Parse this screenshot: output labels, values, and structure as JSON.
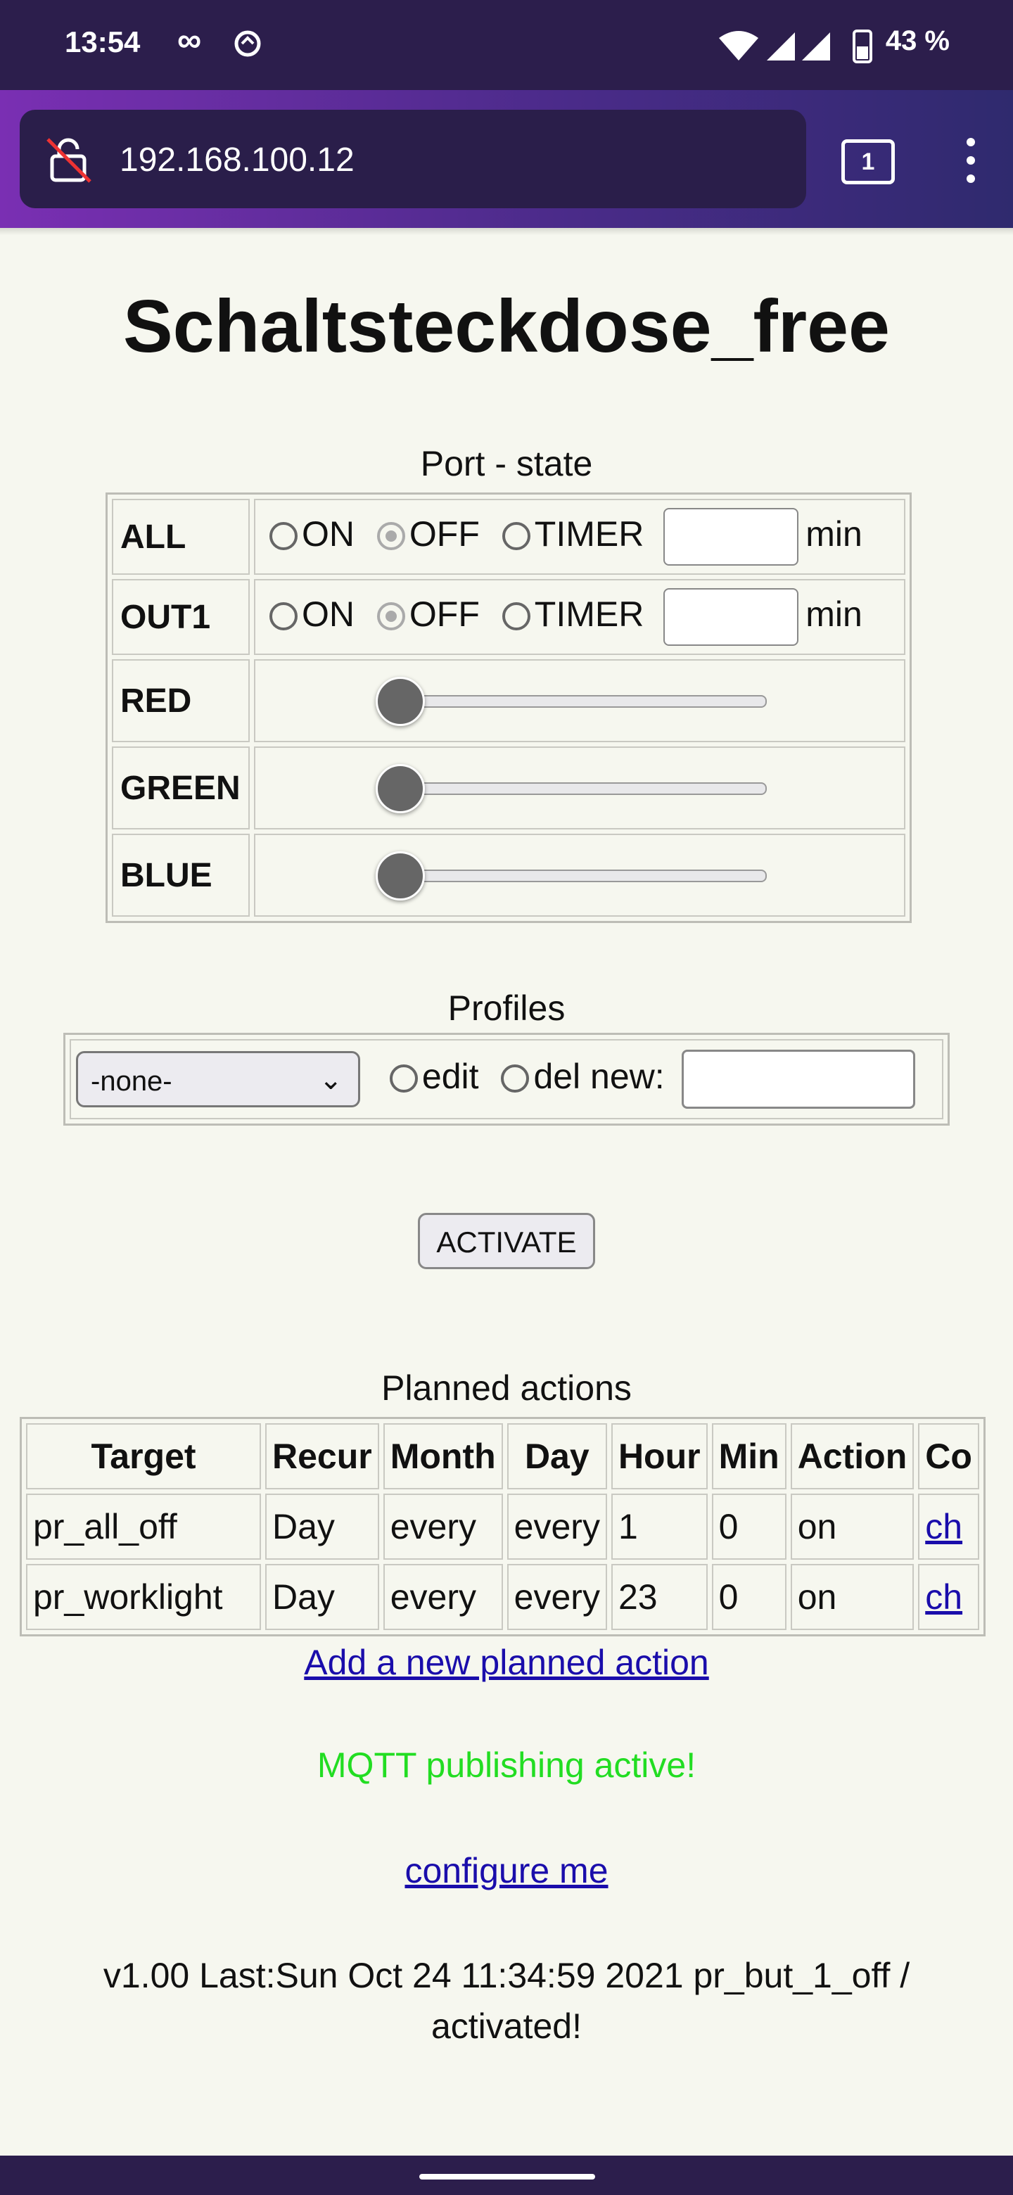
{
  "status_bar": {
    "time": "13:54",
    "battery": "43 %",
    "icons": [
      "infinity-icon",
      "sync-icon",
      "wifi-icon",
      "signal-icon",
      "signal-icon",
      "battery-icon"
    ]
  },
  "browser": {
    "url": "192.168.100.12",
    "tab_count": "1"
  },
  "page": {
    "title": "Schaltsteckdose_free",
    "port_caption": "Port - state",
    "ports": [
      {
        "label": "ALL",
        "on": "ON",
        "off": "OFF",
        "timer": "TIMER",
        "unit": "min",
        "selected": "OFF"
      },
      {
        "label": "OUT1",
        "on": "ON",
        "off": "OFF",
        "timer": "TIMER",
        "unit": "min",
        "selected": "OFF"
      }
    ],
    "sliders": [
      {
        "label": "RED",
        "value": 0
      },
      {
        "label": "GREEN",
        "value": 0
      },
      {
        "label": "BLUE",
        "value": 0
      }
    ],
    "profiles_caption": "Profiles",
    "profile_select": "-none-",
    "edit_label": "edit",
    "del_label": "del new:",
    "activate_label": "ACTIVATE",
    "planned_caption": "Planned actions",
    "planned_headers": [
      "Target",
      "Recur",
      "Month",
      "Day",
      "Hour",
      "Min",
      "Action",
      "Co"
    ],
    "planned_rows": [
      {
        "target": "pr_all_off",
        "recur": "Day",
        "month": "every",
        "day": "every",
        "hour": "1",
        "min": "0",
        "action": "on",
        "link": "ch"
      },
      {
        "target": "pr_worklight",
        "recur": "Day",
        "month": "every",
        "day": "every",
        "hour": "23",
        "min": "0",
        "action": "on",
        "link": "ch"
      }
    ],
    "add_action_link": "Add a new planned action",
    "mqtt_status": "MQTT publishing active!",
    "configure_link": "configure me",
    "footer_line1": "v1.00 Last:Sun Oct 24 11:34:59 2021 pr_but_1_off /",
    "footer_line2": "activated!"
  },
  "colors": {
    "background": "#f6f7ef",
    "status_bar": "#2c1e4c",
    "link": "#1a0dab",
    "mqtt_green": "#22dd22"
  }
}
